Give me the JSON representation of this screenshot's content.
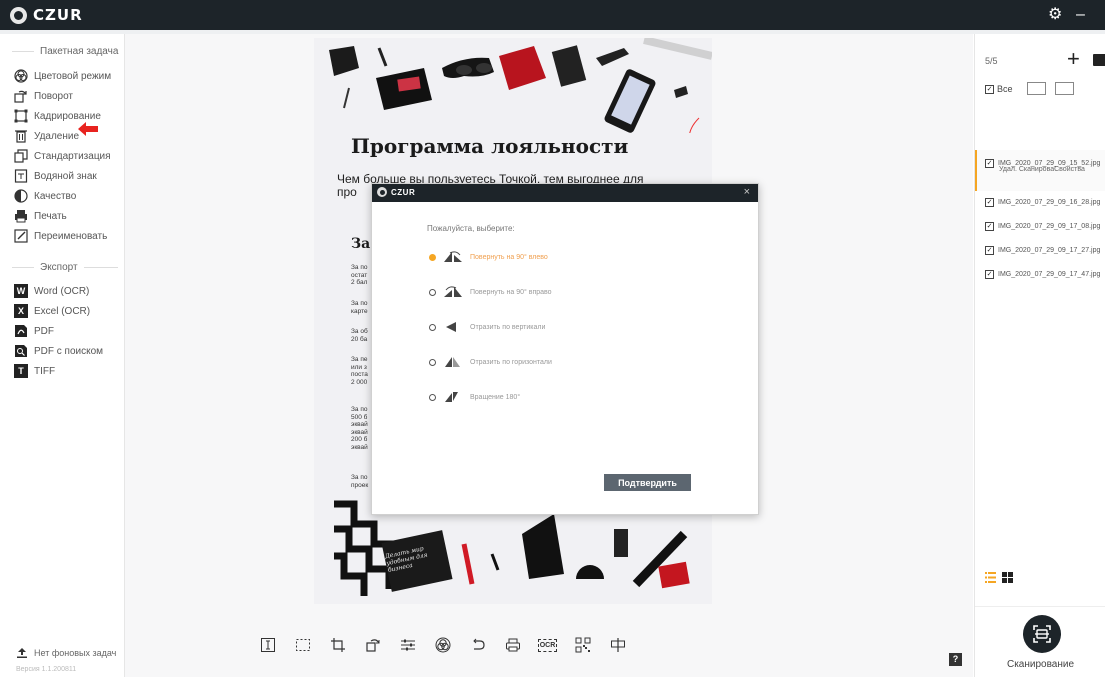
{
  "app": {
    "logo_text": "CZUR"
  },
  "titlebar": {
    "settings_icon": "gear-icon",
    "minimize_label": "–"
  },
  "sidebar": {
    "batch_header": "Пакетная задача",
    "items": [
      {
        "label": "Цветовой режим",
        "icon": "color-mode-icon"
      },
      {
        "label": "Поворот",
        "icon": "rotate-icon"
      },
      {
        "label": "Кадрирование",
        "icon": "crop-icon"
      },
      {
        "label": "Удаление",
        "icon": "delete-icon"
      },
      {
        "label": "Стандартизация",
        "icon": "standardize-icon"
      },
      {
        "label": "Водяной знак",
        "icon": "watermark-icon"
      },
      {
        "label": "Качество",
        "icon": "quality-icon"
      },
      {
        "label": "Печать",
        "icon": "print-icon"
      },
      {
        "label": "Переименовать",
        "icon": "rename-icon"
      }
    ],
    "export_header": "Экспорт",
    "export_items": [
      {
        "label": "Word (OCR)",
        "icon": "word-icon",
        "badge": "W"
      },
      {
        "label": "Excel (OCR)",
        "icon": "excel-icon",
        "badge": "X"
      },
      {
        "label": "PDF",
        "icon": "pdf-icon",
        "badge": ""
      },
      {
        "label": "PDF с поиском",
        "icon": "searchable-pdf-icon",
        "badge": ""
      },
      {
        "label": "TIFF",
        "icon": "tiff-icon",
        "badge": "T"
      }
    ],
    "background_tasks": "Нет фоновых задач",
    "version": "Версия 1.1.200811"
  },
  "document": {
    "title": "Программа лояльности",
    "subtitle": "Чем больше вы пользуетесь Точкой, тем выгоднее для",
    "subtitle_line2": "про",
    "section": "За ч",
    "fragments": [
      "За по\nостат\n2 бал",
      "За по\nкарте",
      "За об\n20 ба",
      "За пе\nили з\nпоста\n2 000",
      "За по\n500 б\nэквай\nэквай\n200 б\nэквай",
      "За по\nпроек"
    ],
    "book_text": "Делать мир удобным для бизнеса"
  },
  "dialog": {
    "logo_text": "CZUR",
    "close_label": "×",
    "prompt": "Пожалуйста, выберите:",
    "options": [
      {
        "label": "Повернуть на 90° влево",
        "selected": true
      },
      {
        "label": "Повернуть на 90° вправо",
        "selected": false
      },
      {
        "label": "Отразить по вертикали",
        "selected": false
      },
      {
        "label": "Отразить по горизонтали",
        "selected": false
      },
      {
        "label": "Вращение 180°",
        "selected": false
      }
    ],
    "confirm_label": "Подтвердить"
  },
  "toolbar": {
    "tools": [
      "text-select-icon",
      "select-area-icon",
      "crop-icon",
      "rotate-icon",
      "adjust-icon",
      "color-icon",
      "undo-icon",
      "print-icon",
      "ocr-icon",
      "qr-icon",
      "split-icon"
    ],
    "ocr_label": "OCR"
  },
  "right_panel": {
    "count": "5/5",
    "select_all_label": "Все",
    "files": [
      {
        "name": "IMG_2020_07_29_09_15_52.jpg",
        "active": true
      },
      {
        "name": "IMG_2020_07_29_09_16_28.jpg",
        "active": false
      },
      {
        "name": "IMG_2020_07_29_09_17_08.jpg",
        "active": false
      },
      {
        "name": "IMG_2020_07_29_09_17_27.jpg",
        "active": false
      },
      {
        "name": "IMG_2020_07_29_09_17_47.jpg",
        "active": false
      }
    ],
    "file_actions": "Удал.   СканироваСвойства",
    "scan_label": "Сканирование"
  },
  "colors": {
    "titlebar": "#1d2429",
    "accent": "#f5a623",
    "arrow": "#e8231f"
  }
}
